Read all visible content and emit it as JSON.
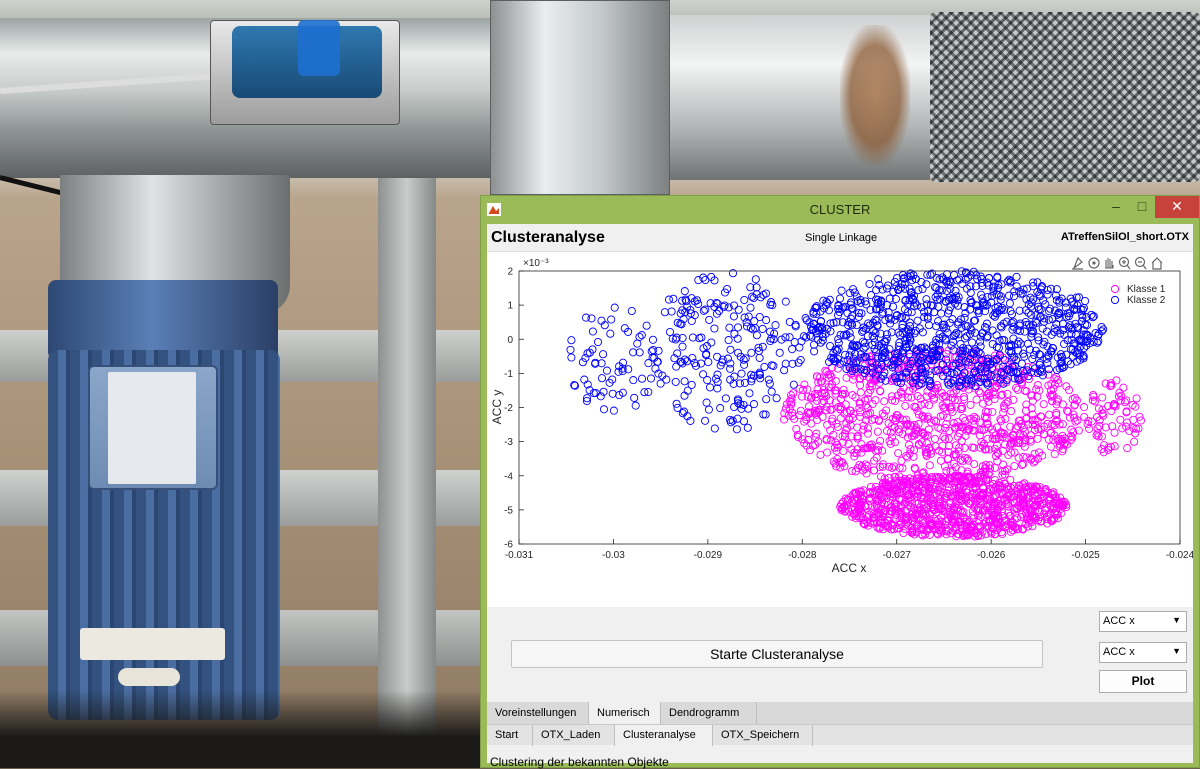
{
  "window": {
    "title": "CLUSTER",
    "minimize_glyph": "–",
    "maximize_glyph": "□",
    "close_glyph": "✕",
    "accent_color": "#9bbb59",
    "close_color": "#c7423a"
  },
  "header": {
    "title": "Clusteranalyse",
    "method": "Single Linkage",
    "file": "ATreffenSilOl_short.OTX"
  },
  "toolbar_icons": [
    "brush-icon",
    "rotate-icon",
    "pan-icon",
    "zoom-in-icon",
    "zoom-out-icon",
    "home-icon"
  ],
  "chart_data": {
    "type": "scatter",
    "xlabel": "ACC x",
    "ylabel": "ACC y",
    "y_exponent": "×10⁻³",
    "xlim": [
      -0.031,
      -0.024
    ],
    "ylim": [
      -6,
      2
    ],
    "x_ticks": [
      "-0.031",
      "-0.03",
      "-0.029",
      "-0.028",
      "-0.027",
      "-0.026",
      "-0.025",
      "-0.024"
    ],
    "y_ticks": [
      "2",
      "1",
      "0",
      "-1",
      "-2",
      "-3",
      "-4",
      "-5",
      "-6"
    ],
    "legend_position": "top-right",
    "series": [
      {
        "name": "Klasse 1",
        "color": "#ff00ff",
        "marker": "circle-open",
        "regions": [
          {
            "xmin": -0.0282,
            "xmax": -0.025,
            "ymin": -4.2,
            "ymax": -0.3,
            "density": "high"
          },
          {
            "xmin": -0.0276,
            "xmax": -0.0252,
            "ymin": -5.8,
            "ymax": -4.0,
            "density": "high"
          },
          {
            "xmin": -0.025,
            "xmax": -0.0244,
            "ymin": -3.4,
            "ymax": -1.2,
            "density": "low"
          }
        ]
      },
      {
        "name": "Klasse 2",
        "color": "#0000ff",
        "marker": "circle-open",
        "regions": [
          {
            "xmin": -0.028,
            "xmax": -0.0248,
            "ymin": -1.4,
            "ymax": 2.0,
            "density": "high"
          },
          {
            "xmin": -0.0296,
            "xmax": -0.028,
            "ymin": -2.7,
            "ymax": 2.0,
            "density": "medium"
          },
          {
            "xmin": -0.0305,
            "xmax": -0.0295,
            "ymin": -2.2,
            "ymax": 1.0,
            "density": "low"
          }
        ]
      }
    ]
  },
  "controls": {
    "x_select": "ACC x",
    "y_select": "ACC x",
    "plot_button": "Plot",
    "start_button": "Starte Clusteranalyse"
  },
  "tabs_top": [
    {
      "label": "Voreinstellungen",
      "selected": false
    },
    {
      "label": "Numerisch",
      "selected": true
    },
    {
      "label": "Dendrogramm",
      "selected": false
    }
  ],
  "tabs_bottom": [
    {
      "label": "Start",
      "selected": false
    },
    {
      "label": "OTX_Laden",
      "selected": false
    },
    {
      "label": "Clusteranalyse",
      "selected": true
    },
    {
      "label": "OTX_Speichern",
      "selected": false
    }
  ],
  "status": "Clustering der bekannten Objekte"
}
